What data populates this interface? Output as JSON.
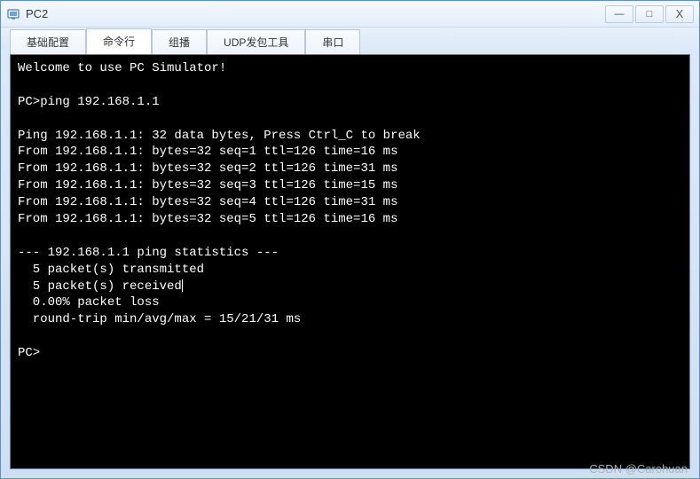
{
  "window": {
    "title": "PC2"
  },
  "controls": {
    "minimize": "—",
    "maximize": "□",
    "close": "X"
  },
  "tabs": [
    {
      "label": "基础配置",
      "active": false
    },
    {
      "label": "命令行",
      "active": true
    },
    {
      "label": "组播",
      "active": false
    },
    {
      "label": "UDP发包工具",
      "active": false
    },
    {
      "label": "串口",
      "active": false
    }
  ],
  "terminal": {
    "lines": [
      "Welcome to use PC Simulator!",
      "",
      "PC>ping 192.168.1.1",
      "",
      "Ping 192.168.1.1: 32 data bytes, Press Ctrl_C to break",
      "From 192.168.1.1: bytes=32 seq=1 ttl=126 time=16 ms",
      "From 192.168.1.1: bytes=32 seq=2 ttl=126 time=31 ms",
      "From 192.168.1.1: bytes=32 seq=3 ttl=126 time=15 ms",
      "From 192.168.1.1: bytes=32 seq=4 ttl=126 time=31 ms",
      "From 192.168.1.1: bytes=32 seq=5 ttl=126 time=16 ms",
      "",
      "--- 192.168.1.1 ping statistics ---",
      "  5 packet(s) transmitted",
      "  5 packet(s) received",
      "  0.00% packet loss",
      "  round-trip min/avg/max = 15/21/31 ms",
      "",
      "PC>"
    ]
  },
  "watermark": "CSDN @Carohuan"
}
